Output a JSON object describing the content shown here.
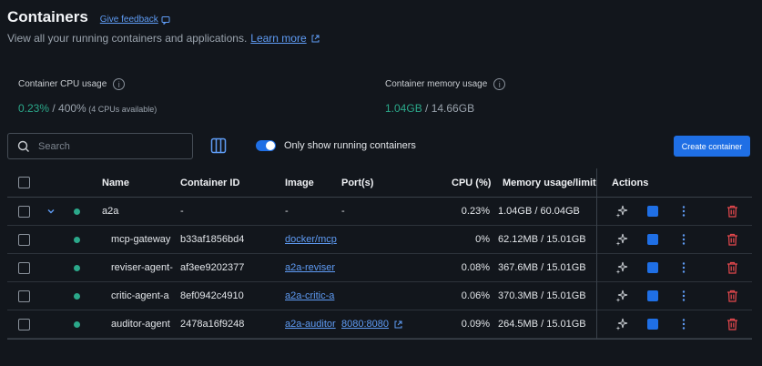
{
  "header": {
    "title": "Containers",
    "feedback_label": "Give feedback",
    "subtitle": "View all your running containers and applications.",
    "learn_more": "Learn more"
  },
  "stats": {
    "cpu": {
      "label": "Container CPU usage",
      "used": "0.23%",
      "total": " / 400%",
      "note": " (4 CPUs available)"
    },
    "memory": {
      "label": "Container memory usage",
      "used": "1.04GB",
      "total": " / 14.66GB"
    }
  },
  "toolbar": {
    "search_placeholder": "Search",
    "toggle_label": "Only show running containers",
    "create_button": "Create container"
  },
  "table": {
    "headers": {
      "name": "Name",
      "container_id": "Container ID",
      "image": "Image",
      "ports": "Port(s)",
      "cpu": "CPU (%)",
      "memory": "Memory usage/limit",
      "actions": "Actions"
    },
    "rows": [
      {
        "name": "a2a",
        "id": "-",
        "image": "-",
        "ports": "-",
        "cpu": "0.23%",
        "memory": "1.04GB / 60.04GB"
      },
      {
        "name": "mcp-gateway",
        "id": "b33af1856bd4",
        "image": "docker/mcp",
        "ports": "",
        "cpu": "0%",
        "memory": "62.12MB / 15.01GB"
      },
      {
        "name": "reviser-agent-",
        "id": "af3ee9202377",
        "image": "a2a-reviser",
        "ports": "",
        "cpu": "0.08%",
        "memory": "367.6MB / 15.01GB"
      },
      {
        "name": "critic-agent-a",
        "id": "8ef0942c4910",
        "image": "a2a-critic-a",
        "ports": "",
        "cpu": "0.06%",
        "memory": "370.3MB / 15.01GB"
      },
      {
        "name": "auditor-agent",
        "id": "2478a16f9248",
        "image": "a2a-auditor",
        "ports": "8080:8080",
        "cpu": "0.09%",
        "memory": "264.5MB / 15.01GB"
      }
    ]
  },
  "colors": {
    "accent": "#1f6fe5",
    "running": "#2ba88a",
    "delete": "#e5484d",
    "link": "#5f9cf5"
  }
}
